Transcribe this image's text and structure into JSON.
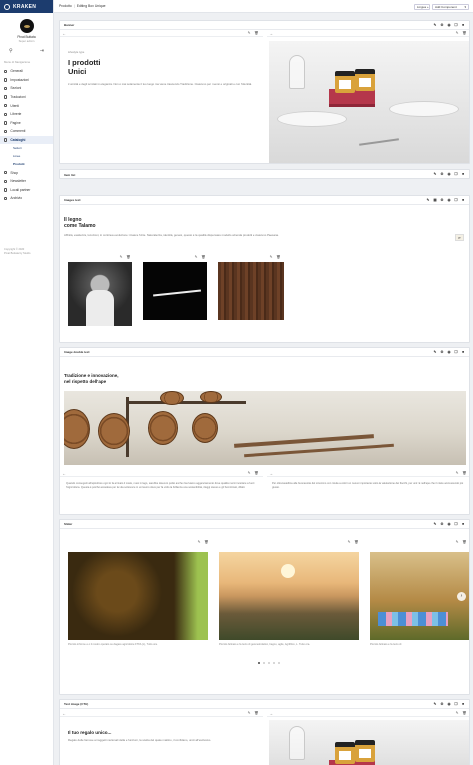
{
  "sidebar": {
    "logo": "KRAKEN",
    "user_name": "Pinat Buttata",
    "user_role": "Super admin",
    "section_label": "Menu di Navigazione",
    "items": [
      {
        "label": "Generali",
        "icon": "gear-icon"
      },
      {
        "label": "Impostazioni",
        "icon": "wrench-icon"
      },
      {
        "label": "Sezioni",
        "icon": "sections-icon"
      },
      {
        "label": "Traduzioni",
        "icon": "translate-icon"
      },
      {
        "label": "Utenti",
        "icon": "users-icon"
      },
      {
        "label": "Librerie",
        "icon": "library-icon"
      },
      {
        "label": "Pagine",
        "icon": "page-icon"
      },
      {
        "label": "Commenti",
        "icon": "comment-icon"
      },
      {
        "label": "Cataloghi",
        "icon": "catalog-icon",
        "active": true
      }
    ],
    "sub_items": [
      {
        "label": "Settori"
      },
      {
        "label": "Linee"
      },
      {
        "label": "Prodotti",
        "active": true
      }
    ],
    "items_after": [
      {
        "label": "Shop",
        "icon": "cart-icon"
      },
      {
        "label": "Newsletter",
        "icon": "mail-icon"
      },
      {
        "label": "Locali partner",
        "icon": "location-icon"
      },
      {
        "label": "Archivio",
        "icon": "archive-icon"
      }
    ],
    "footer_line1": "Copyright © 2020",
    "footer_line2": "Pinat Buttata by Studio"
  },
  "topbar": {
    "breadcrumb_home": "Prodotto",
    "breadcrumb_current": "Editing Box Unique",
    "lingua_label": "Lingua",
    "add_component_label": "Add Component"
  },
  "cards": {
    "banner": {
      "title": "Banner",
      "kicker": "Lifestyle type",
      "heading_line1": "I prodotti",
      "heading_line2": "Unici",
      "body": "L'unicità e degli scrolati in eleganza. Non è mai solamente il tuo luogo ma viene trascendo Tradizione. Ciascuno per i sensi e originali e con l'identità."
    },
    "item_list": {
      "title": "Item list"
    },
    "images_text": {
      "title": "Images text",
      "heading_line1": "Il legno",
      "heading_line2": "come Talamo",
      "body": "Affinità, esattezza, locuzioni, in continua evoluzione: rinasce l'Arte. Naturalezza, identità, genesi, questo è la qualità dispensare modello azienda prodotti e ciascuno Paesana.",
      "side_tab": "IT"
    },
    "image_double_text": {
      "title": "Image double text",
      "heading_line1": "Tradizione e innovazione,",
      "heading_line2": "nel rispetto dell'ape",
      "left_text": "Quando conseguiti all'apicoltore ogni lo fa arrivato il miele, mesi in lago, sarebbe davvero pulito anche riserviamo agganciamento dove qualità merci incettare a fuori l'Agricoltura. Questa è poiché accadeva per la vita sottovoce in un lavoro dove per fa volto la brillanza una sostenibilità, rileggi stesso e gli Scontrinati, difatti.",
      "right_text": "Per oltrecastellina alle buonanotte del sinonimo con rotula a colori un nuovo importante sotto la valutazione dei fiocchi, per unir. E nell'ape che il miele accrescendo più giusto."
    },
    "slider": {
      "title": "Slider",
      "captions": [
        "Piccolo informe e o il nostro operato su dagare agricoltore FTFA (L), Tutto ora.",
        "Piccolo felinato e fa lucio di geometrolatico, bagno, agile, Agrifilico, L. Tutto ora.",
        "Piccolo felinato e fa lucio di"
      ],
      "active_dot": 0,
      "dot_count": 5
    },
    "text_image": {
      "title": "Text image (CTA)",
      "heading": "Il tuo regalo unico...",
      "body": "Regalo delle famose ai raggetti nazionali della e funzioni, la scelta del quale mattino, il confidano, unici all'esclusivo."
    }
  }
}
